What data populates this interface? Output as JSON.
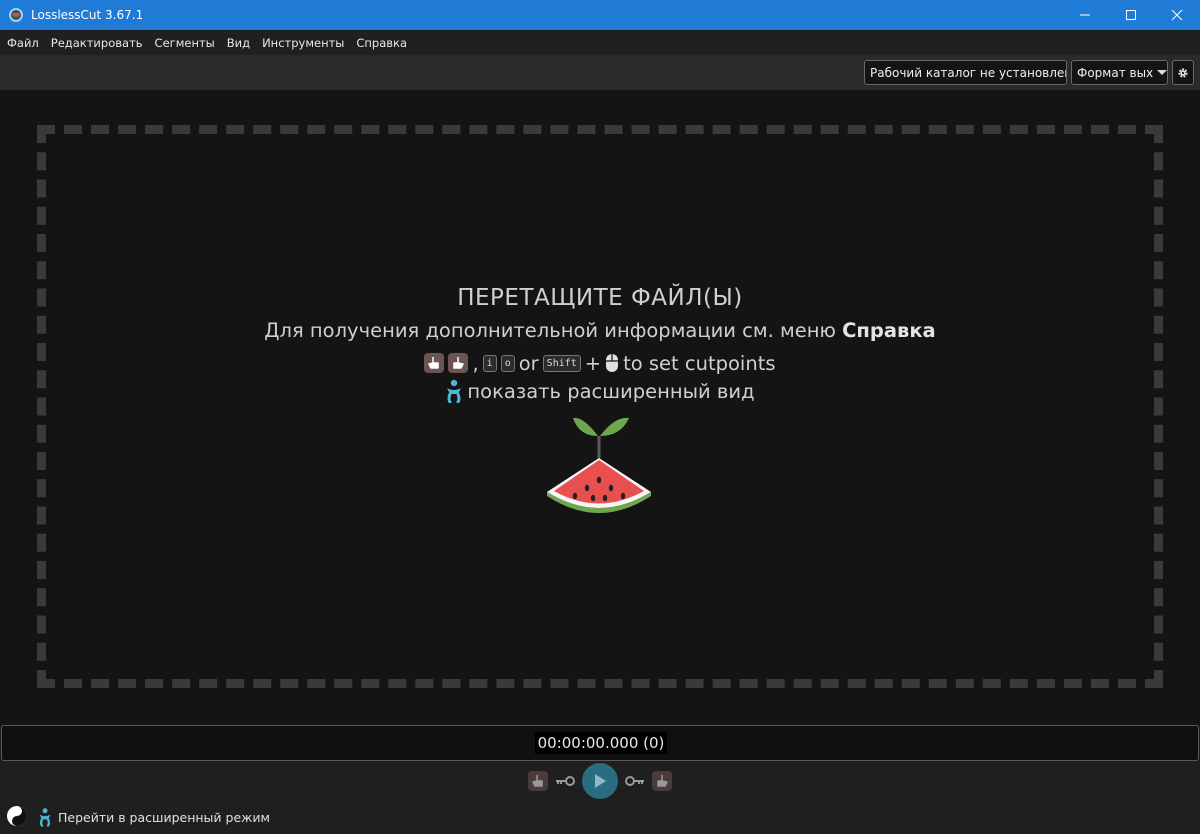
{
  "window": {
    "title": "LosslessCut 3.67.1"
  },
  "menu": {
    "items": [
      "Файл",
      "Редактировать",
      "Сегменты",
      "Вид",
      "Инструменты",
      "Справка"
    ]
  },
  "toolbar": {
    "working_dir_label": "Рабочий каталог не установлен",
    "format_label": "Формат вых"
  },
  "dropzone": {
    "title": "ПЕРЕТАЩИТЕ ФАЙЛ(Ы)",
    "help_prefix": "Для получения дополнительной информации см. меню",
    "help_menu": "Справка",
    "key_in": "i",
    "key_out": "o",
    "or_text": "or",
    "key_shift": "Shift",
    "plus": "+",
    "comma": ",",
    "cutpoints_text": "to set cutpoints",
    "advanced_view_text": "показать расширенный вид"
  },
  "timeline": {
    "timecode": "00:00:00.000 (0)"
  },
  "bottom": {
    "advanced_mode_label": "Перейти в расширенный режим"
  },
  "colors": {
    "titlebar": "#1f7bd6",
    "accent_teal": "#2a6c80",
    "advanced_icon": "#4fb6d6",
    "dropzone_border": "#3a3a3a"
  },
  "icons": [
    "app-icon",
    "minimize-icon",
    "maximize-icon",
    "close-icon",
    "caret-down-icon",
    "gear-icon",
    "hand-start-icon",
    "hand-end-icon",
    "mouse-icon",
    "baby-icon",
    "watermelon-icon",
    "key-icon",
    "play-icon",
    "yin-yang-icon"
  ]
}
